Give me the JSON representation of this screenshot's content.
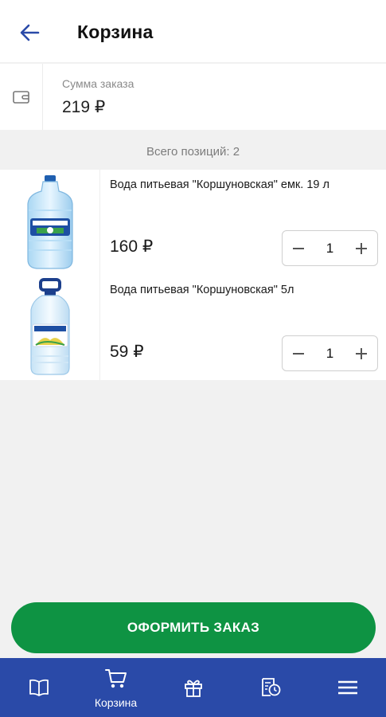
{
  "header": {
    "title": "Корзина",
    "back_icon": "arrow-left-icon"
  },
  "summary": {
    "label": "Сумма заказа",
    "value": "219 ₽",
    "icon": "wallet-icon"
  },
  "count_text": "Всего позиций: 2",
  "cart_items": [
    {
      "name": "Вода питьевая \"Коршуновская\" емк. 19 л",
      "price": "160 ₽",
      "quantity": "1",
      "image": "water-bottle-19l"
    },
    {
      "name": "Вода питьевая \"Коршуновская\" 5л",
      "price": "59 ₽",
      "quantity": "1",
      "image": "water-bottle-5l"
    }
  ],
  "checkout_label": "ОФОРМИТЬ ЗАКАЗ",
  "bottom_nav": [
    {
      "icon": "catalog-book-icon",
      "label": ""
    },
    {
      "icon": "cart-icon",
      "label": "Корзина",
      "active": true
    },
    {
      "icon": "gift-icon",
      "label": ""
    },
    {
      "icon": "orders-history-icon",
      "label": ""
    },
    {
      "icon": "menu-icon",
      "label": ""
    }
  ],
  "colors": {
    "primary_blue": "#2a4aa8",
    "accent_green": "#0e9343",
    "back_arrow": "#2a4aa8"
  }
}
